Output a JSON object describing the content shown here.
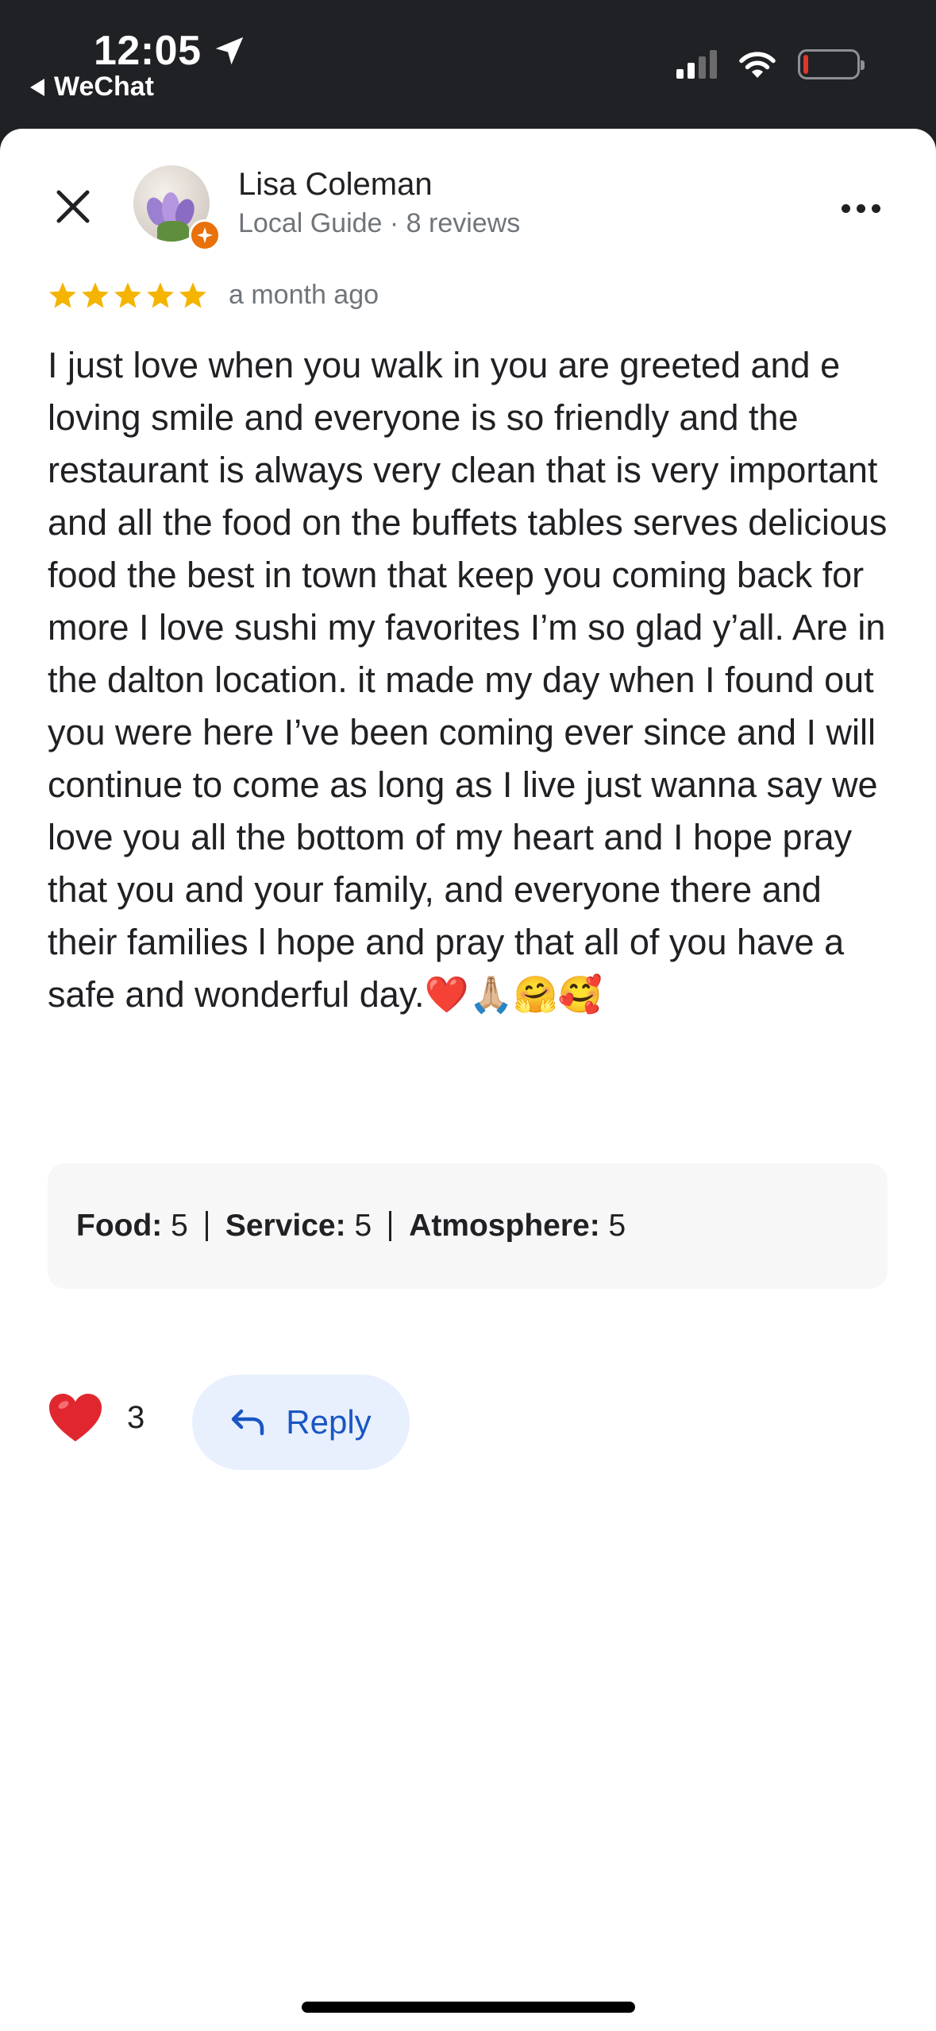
{
  "status_bar": {
    "time": "12:05",
    "back_app": "WeChat",
    "battery_level_percent": 10,
    "signal_bars": 2
  },
  "review": {
    "author_name": "Lisa Coleman",
    "author_meta": "Local Guide · 8 reviews",
    "rating_stars": 5,
    "date": "a month ago",
    "text": "I just love when you walk in  you are greeted and e loving smile and everyone is so friendly and the restaurant is always very clean that is very important and all the food on the buffets tables serves delicious food the best in town that keep you coming back for more I love sushi my favorites I’m so glad y’all. Are in the dalton location. it made my day when I found out you were here I’ve been coming ever since and I will continue to come as long as I live just wanna say we love you all the bottom of my heart and I hope pray that you and your family, and everyone there and their families l hope and pray that all of you have a safe and  wonderful day.",
    "text_emojis": "❤️🙏🏼🤗🥰",
    "attributes": [
      {
        "label": "Food:",
        "value": "5"
      },
      {
        "label": "Service:",
        "value": "5"
      },
      {
        "label": "Atmosphere:",
        "value": "5"
      }
    ],
    "like_count": "3",
    "reply_label": "Reply"
  },
  "colors": {
    "star": "#F4B400",
    "guide_badge": "#E8710A",
    "reply_bg": "#E8F0FE",
    "reply_text": "#1A56C4",
    "heart": "#E0272F"
  },
  "icons": {
    "close": "close-icon",
    "more": "more-icon",
    "reply": "reply-arrow-icon",
    "like": "heart-icon"
  }
}
